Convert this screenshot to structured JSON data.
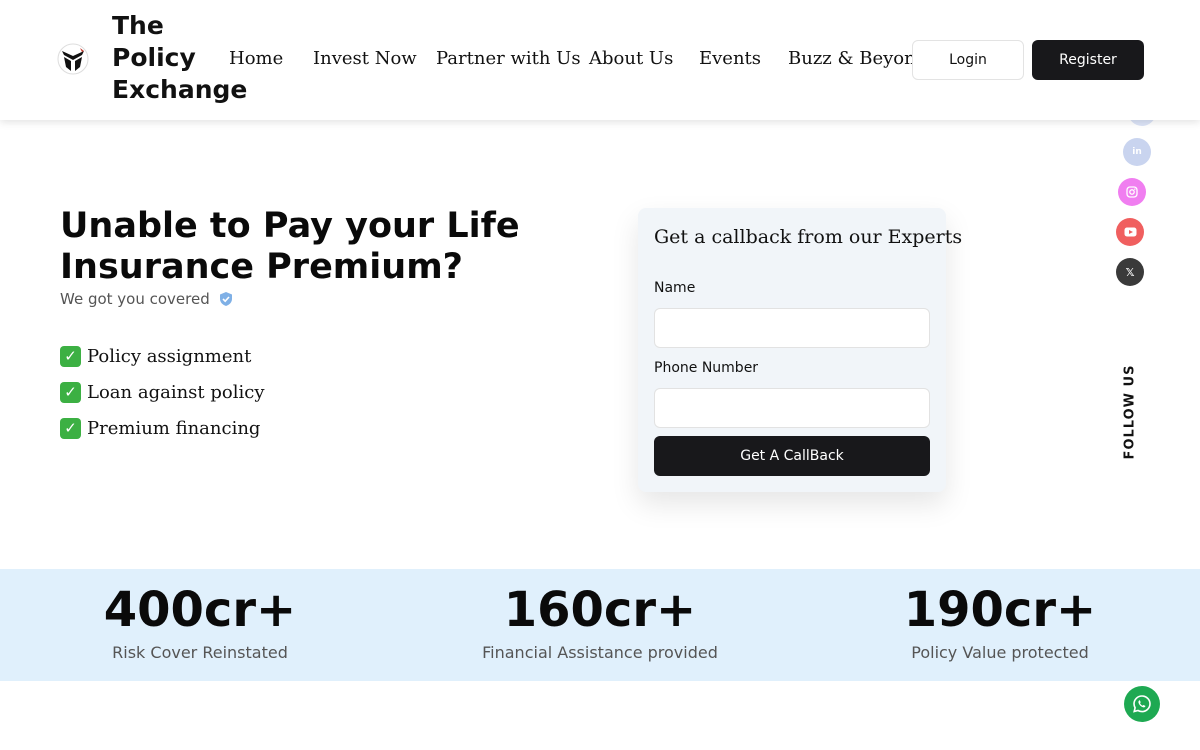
{
  "header": {
    "brand_lines": [
      "The",
      "Policy",
      "Exchange"
    ],
    "nav": [
      "Home",
      "Invest Now",
      "Partner with Us",
      "About Us",
      "Events",
      "Buzz & Beyond"
    ],
    "login_label": "Login",
    "register_label": "Register"
  },
  "hero": {
    "title": "Unable to Pay your Life Insurance Premium?",
    "subtitle": "We got you covered",
    "features": [
      "Policy assignment",
      "Loan against policy",
      "Premium financing"
    ]
  },
  "callback": {
    "title": "Get a callback from our Experts",
    "name_label": "Name",
    "phone_label": "Phone Number",
    "button_label": "Get A CallBack"
  },
  "social": {
    "follow_label": "FOLLOW US",
    "icons": [
      "facebook-icon",
      "linkedin-icon",
      "instagram-icon",
      "youtube-icon",
      "x-icon"
    ],
    "colors": {
      "facebook": "#dbe3f7",
      "linkedin": "#c9d4ef",
      "instagram": "#f07ef0",
      "youtube": "#f05f5f",
      "x": "#3a3a3a"
    }
  },
  "stats": [
    {
      "value": "400cr+",
      "label": "Risk Cover Reinstated"
    },
    {
      "value": "160cr+",
      "label": "Financial Assistance provided"
    },
    {
      "value": "190cr+",
      "label": "Policy Value protected"
    }
  ],
  "colors": {
    "accent_dark": "#18181b",
    "stats_bg": "#e0f0fc",
    "whatsapp": "#1ea952"
  }
}
